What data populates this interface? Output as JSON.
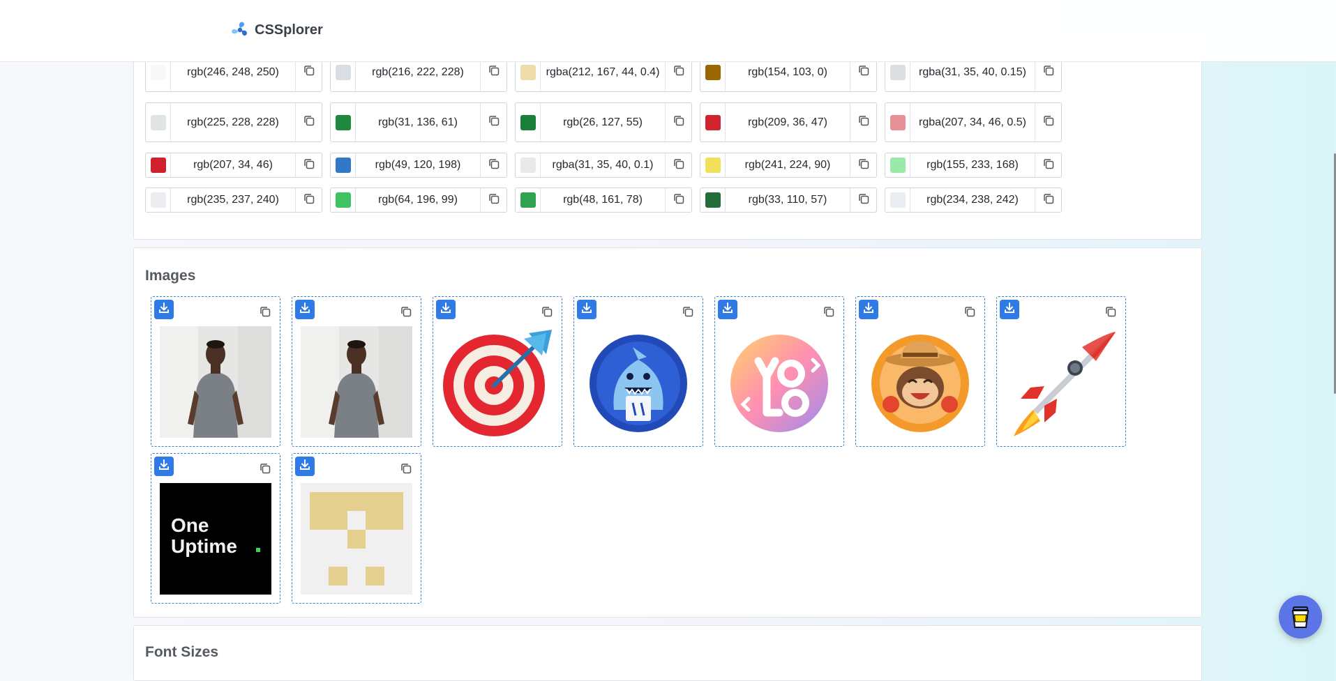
{
  "header": {
    "brand_name": "CSSplorer"
  },
  "colors": {
    "rows": [
      [
        {
          "value": "rgb(246, 248, 250)",
          "swatch": "#f6f8fa"
        },
        {
          "value": "rgb(216, 222, 228)",
          "swatch": "#d8dee4"
        },
        {
          "value": "rgba(212, 167, 44, 0.4)",
          "swatch": "#eedcab"
        },
        {
          "value": "rgb(154, 103, 0)",
          "swatch": "#9a6700"
        },
        {
          "value": "rgba(31, 35, 40, 0.15)",
          "swatch": "#dddedf"
        }
      ],
      [
        {
          "value": "rgb(225, 228, 228)",
          "swatch": "#e1e4e4"
        },
        {
          "value": "rgb(31, 136, 61)",
          "swatch": "#1f883d"
        },
        {
          "value": "rgb(26, 127, 55)",
          "swatch": "#1a7f37"
        },
        {
          "value": "rgb(209, 36, 47)",
          "swatch": "#d1242f"
        },
        {
          "value": "rgba(207, 34, 46, 0.5)",
          "swatch": "#e79096"
        }
      ],
      [
        {
          "value": "rgb(207, 34, 46)",
          "swatch": "#cf222e"
        },
        {
          "value": "rgb(49, 120, 198)",
          "swatch": "#3178c6"
        },
        {
          "value": "rgba(31, 35, 40, 0.1)",
          "swatch": "#e9e9e9"
        },
        {
          "value": "rgb(241, 224, 90)",
          "swatch": "#f1e05a"
        },
        {
          "value": "rgb(155, 233, 168)",
          "swatch": "#9be9a8"
        }
      ],
      [
        {
          "value": "rgb(235, 237, 240)",
          "swatch": "#ebedf0"
        },
        {
          "value": "rgb(64, 196, 99)",
          "swatch": "#40c463"
        },
        {
          "value": "rgb(48, 161, 78)",
          "swatch": "#30a14e"
        },
        {
          "value": "rgb(33, 110, 57)",
          "swatch": "#216e39"
        },
        {
          "value": "rgb(234, 238, 242)",
          "swatch": "#eaeef2"
        }
      ]
    ]
  },
  "images": {
    "title": "Images",
    "items": [
      {
        "kind": "photo-person"
      },
      {
        "kind": "photo-person"
      },
      {
        "kind": "target-emoji"
      },
      {
        "kind": "shark-logo"
      },
      {
        "kind": "yolo-sticker"
      },
      {
        "kind": "cowboy-monkey"
      },
      {
        "kind": "rocket-emoji"
      },
      {
        "kind": "oneuptime-logo",
        "logo_text": [
          "One",
          "Uptime"
        ]
      },
      {
        "kind": "identicon"
      }
    ]
  },
  "next_section": {
    "title": "Font Sizes"
  },
  "accent_color": "#2f7ae5",
  "float_button": {
    "icon": "coffee-cup-icon"
  }
}
